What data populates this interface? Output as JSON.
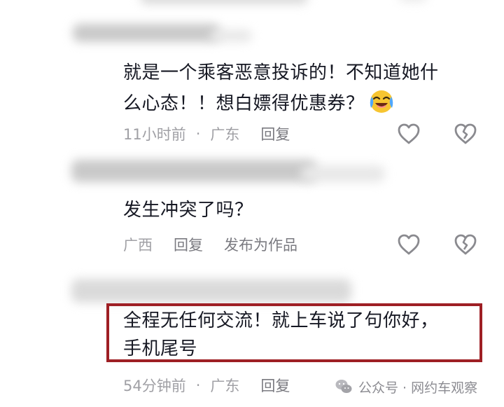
{
  "comments": [
    {
      "text": "就是一个乘客恶意投诉的！不知道她什么心态！！想白嫖得优惠券？",
      "line1": "就是一个乘客恶意投诉的！不知道她什",
      "line2": "么心态！！想白嫖得优惠券？",
      "emoji": "crying-laughing-emoji",
      "time": "11小时前",
      "separator": "·",
      "location": "广东",
      "reply": "回复"
    },
    {
      "text": "发生冲突了吗？",
      "location": "广西",
      "reply": "回复",
      "publish": "发布为作品"
    },
    {
      "text": "全程无任何交流！就上车说了句你好，手机尾号",
      "line1": "全程无任何交流！就上车说了句你好，",
      "line2": "手机尾号",
      "time": "54分钟前",
      "separator": "·",
      "location": "广东",
      "reply": "回复"
    }
  ],
  "watermark": {
    "text": "公众号 · 网约车观察",
    "icon": "wechat-icon"
  },
  "colors": {
    "text": "#161823",
    "meta": "#a0a0a5",
    "highlight_border": "#9e1f24",
    "icon_stroke": "#8a8a8f"
  },
  "icons": [
    "like-heart-icon",
    "dislike-broken-heart-icon"
  ]
}
